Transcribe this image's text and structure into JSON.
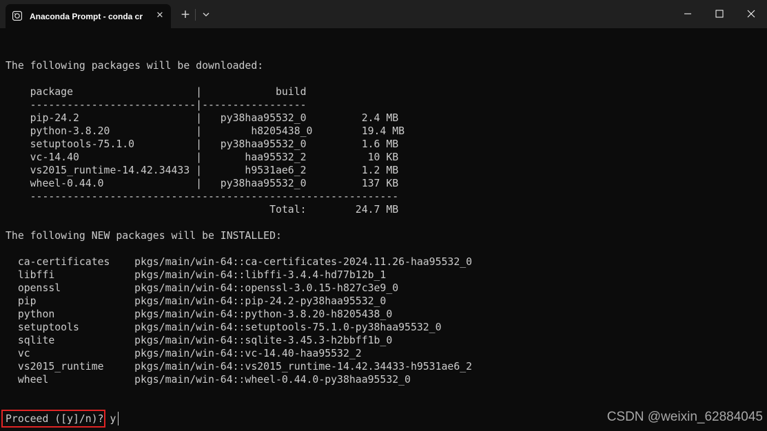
{
  "titlebar": {
    "tab_title": "Anaconda Prompt - conda  cr",
    "tab_icon": "anaconda-prompt-icon",
    "close_tab_icon": "close-icon",
    "new_tab_glyph": "+",
    "new_tab_icon": "plus-icon",
    "dropdown_icon": "chevron-down-icon",
    "window_controls": [
      "minimize-icon",
      "maximize-icon",
      "close-icon"
    ],
    "colors": {
      "bar": "#202020",
      "tab": "#0c0c0c"
    }
  },
  "terminal": {
    "background": "#0c0c0c",
    "foreground": "#cccccc",
    "lines": [
      "The following packages will be downloaded:",
      "",
      "    package                    |            build",
      "    ---------------------------|-----------------",
      "    pip-24.2                   |   py38haa95532_0         2.4 MB",
      "    python-3.8.20              |        h8205438_0        19.4 MB",
      "    setuptools-75.1.0          |   py38haa95532_0         1.6 MB",
      "    vc-14.40                   |       haa95532_2          10 KB",
      "    vs2015_runtime-14.42.34433 |       h9531ae6_2         1.2 MB",
      "    wheel-0.44.0               |   py38haa95532_0         137 KB",
      "    ------------------------------------------------------------",
      "                                           Total:        24.7 MB",
      "",
      "The following NEW packages will be INSTALLED:",
      "",
      "  ca-certificates    pkgs/main/win-64::ca-certificates-2024.11.26-haa95532_0",
      "  libffi             pkgs/main/win-64::libffi-3.4.4-hd77b12b_1",
      "  openssl            pkgs/main/win-64::openssl-3.0.15-h827c3e9_0",
      "  pip                pkgs/main/win-64::pip-24.2-py38haa95532_0",
      "  python             pkgs/main/win-64::python-3.8.20-h8205438_0",
      "  setuptools         pkgs/main/win-64::setuptools-75.1.0-py38haa95532_0",
      "  sqlite             pkgs/main/win-64::sqlite-3.45.3-h2bbff1b_0",
      "  vc                 pkgs/main/win-64::vc-14.40-haa95532_2",
      "  vs2015_runtime     pkgs/main/win-64::vs2015_runtime-14.42.34433-h9531ae6_2",
      "  wheel              pkgs/main/win-64::wheel-0.44.0-py38haa95532_0",
      "",
      "",
      "Proceed ([y]/n)? y"
    ],
    "highlight_color": "#e02424"
  },
  "watermark": "CSDN @weixin_62884045"
}
